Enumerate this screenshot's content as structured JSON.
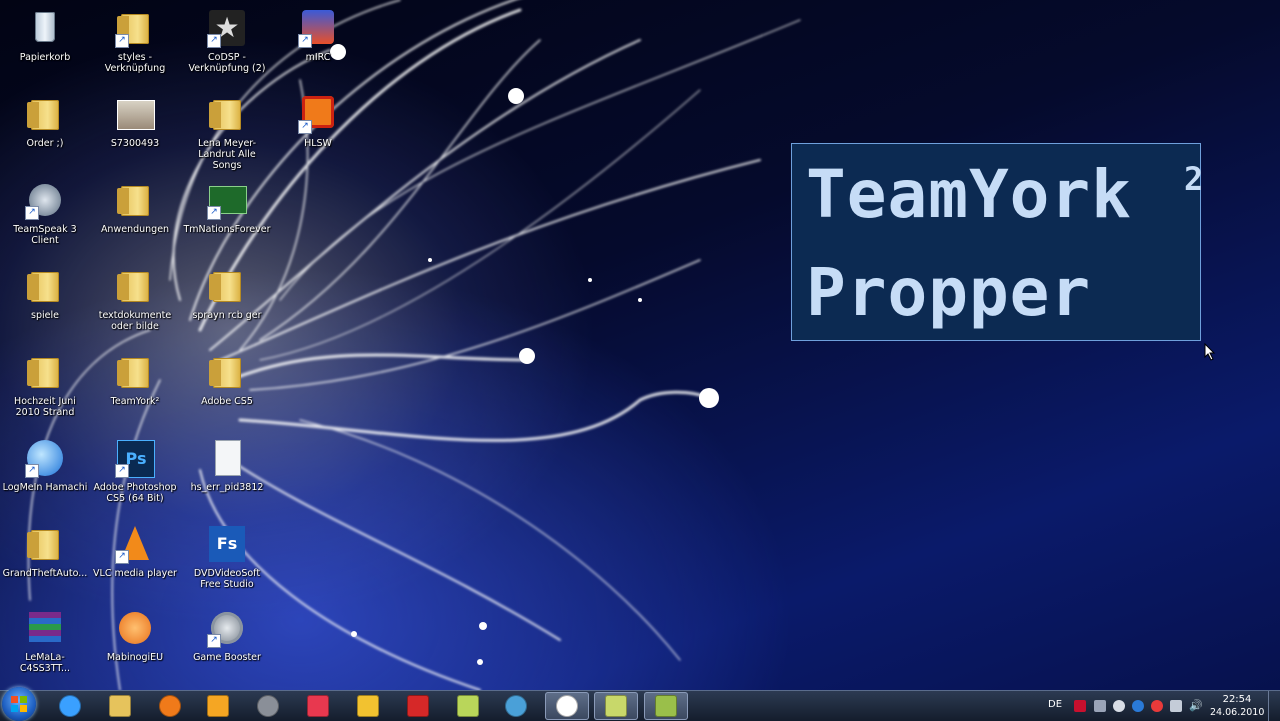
{
  "desktop": {
    "icons": [
      {
        "label": "Papierkorb",
        "icon": "recycle-bin-icon"
      },
      {
        "label": "styles - Verknüpfung",
        "icon": "folder-icon"
      },
      {
        "label": "CoDSP - Verknüpfung (2)",
        "icon": "star-app-icon"
      },
      {
        "label": "mIRC",
        "icon": "mirc-icon"
      },
      {
        "label": "Order ;)",
        "icon": "folder-icon"
      },
      {
        "label": "S7300493",
        "icon": "photo-icon"
      },
      {
        "label": "Lena Meyer-Landrut Alle Songs",
        "icon": "folder-icon"
      },
      {
        "label": "HLSW",
        "icon": "hlsw-icon"
      },
      {
        "label": "TeamSpeak 3 Client",
        "icon": "teamspeak-icon"
      },
      {
        "label": "Anwendungen",
        "icon": "folder-icon"
      },
      {
        "label": "TmNationsForever",
        "icon": "trackmania-icon"
      },
      {
        "label": "spiele",
        "icon": "folder-icon"
      },
      {
        "label": "textdokumente oder bilde",
        "icon": "folder-icon"
      },
      {
        "label": "sprayn rcb ger",
        "icon": "folder-icon"
      },
      {
        "label": "Hochzeit Juni 2010 Strand",
        "icon": "folder-icon"
      },
      {
        "label": "TeamYork²",
        "icon": "folder-icon"
      },
      {
        "label": "Adobe CS5",
        "icon": "folder-icon"
      },
      {
        "label": "LogMeIn Hamachi",
        "icon": "hamachi-icon"
      },
      {
        "label": "Adobe Photoshop CS5 (64 Bit)",
        "icon": "photoshop-icon"
      },
      {
        "label": "hs_err_pid3812",
        "icon": "text-file-icon"
      },
      {
        "label": "GrandTheftAuto...",
        "icon": "folder-icon"
      },
      {
        "label": "VLC media player",
        "icon": "vlc-icon"
      },
      {
        "label": "DVDVideoSoft Free Studio",
        "icon": "freestudio-icon"
      },
      {
        "label": "LeMaLa-C4SS3TT...",
        "icon": "winrar-icon"
      },
      {
        "label": "MabinogiEU",
        "icon": "mabinogi-icon"
      },
      {
        "label": "Game Booster",
        "icon": "game-booster-icon"
      }
    ]
  },
  "promo": {
    "line1": "TeamYork",
    "superscript": "2",
    "line2": "Propper"
  },
  "taskbar": {
    "start_icon": "windows-start-icon",
    "pinned": [
      {
        "name": "internet-explorer",
        "icon": "internet-explorer-icon",
        "color": "#3aa0ff"
      },
      {
        "name": "explorer",
        "icon": "folder-icon",
        "color": "#e6c35c"
      },
      {
        "name": "firefox",
        "icon": "firefox-icon",
        "color": "#f07a1a"
      },
      {
        "name": "media-player",
        "icon": "media-player-icon",
        "color": "#f5a623"
      },
      {
        "name": "steam",
        "icon": "steam-icon",
        "color": "#8a8f98"
      },
      {
        "name": "bg-app",
        "icon": "bg-icon",
        "color": "#e8384f"
      },
      {
        "name": "xfire",
        "icon": "xfire-icon",
        "color": "#f2c230"
      },
      {
        "name": "g-app",
        "icon": "g-icon",
        "color": "#d62828"
      },
      {
        "name": "tool-app",
        "icon": "tool-icon",
        "color": "#b9d65a"
      },
      {
        "name": "teamspeak",
        "icon": "teamspeak-icon",
        "color": "#4aa0d8"
      },
      {
        "name": "steam-active",
        "icon": "steam-icon",
        "color": "#ffffff"
      },
      {
        "name": "notes-active",
        "icon": "notes-icon",
        "color": "#c8d86a"
      },
      {
        "name": "app-active",
        "icon": "app-icon",
        "color": "#9abf4a"
      }
    ],
    "tray": {
      "language": "DE",
      "time": "22:54",
      "date": "24.06.2010"
    }
  }
}
